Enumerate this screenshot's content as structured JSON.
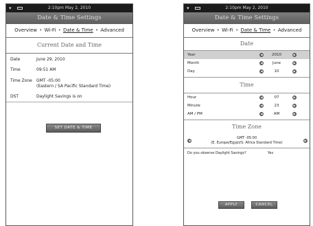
{
  "common": {
    "status_time": "2:10pm May 2, 2010",
    "title": "Date & Time Settings",
    "nav": [
      "Overview",
      "Wi-Fi",
      "Date & Time",
      "Advanced"
    ],
    "nav_sep": "•"
  },
  "left": {
    "section_title": "Current Date and Time",
    "rows": [
      {
        "key": "Date",
        "value": "June 29, 2010"
      },
      {
        "key": "Time",
        "value": "09:51 AM"
      },
      {
        "key": "Time Zone",
        "value": "GMT -05:00",
        "value2": "(Eastern / SA Pacific Standard Time)"
      },
      {
        "key": "DST",
        "value": "Daylight Savings is on"
      }
    ],
    "button": "SET DATE & TIME"
  },
  "right": {
    "date_section": "Date",
    "date_rows": [
      {
        "label": "Year",
        "value": "2010"
      },
      {
        "label": "Month",
        "value": "June"
      },
      {
        "label": "Day",
        "value": "10"
      }
    ],
    "time_section": "Time",
    "time_rows": [
      {
        "label": "Hour",
        "value": "07"
      },
      {
        "label": "Minute",
        "value": "23"
      },
      {
        "label": "AM / PM",
        "value": "AM"
      }
    ],
    "tz_section": "Time Zone",
    "tz_line1": "GMT -05:00",
    "tz_line2": "(E. Europe/Egypt/S. Africa Standard Time)",
    "dst_question": "Do you observe Daylight Savings?",
    "dst_answer": "Yes",
    "apply": "APPLY",
    "cancel": "CANCEL"
  },
  "icons": {
    "left_arrow": "chevron-left-icon",
    "right_arrow": "chevron-right-icon",
    "wifi": "wifi-icon",
    "battery": "battery-icon"
  }
}
